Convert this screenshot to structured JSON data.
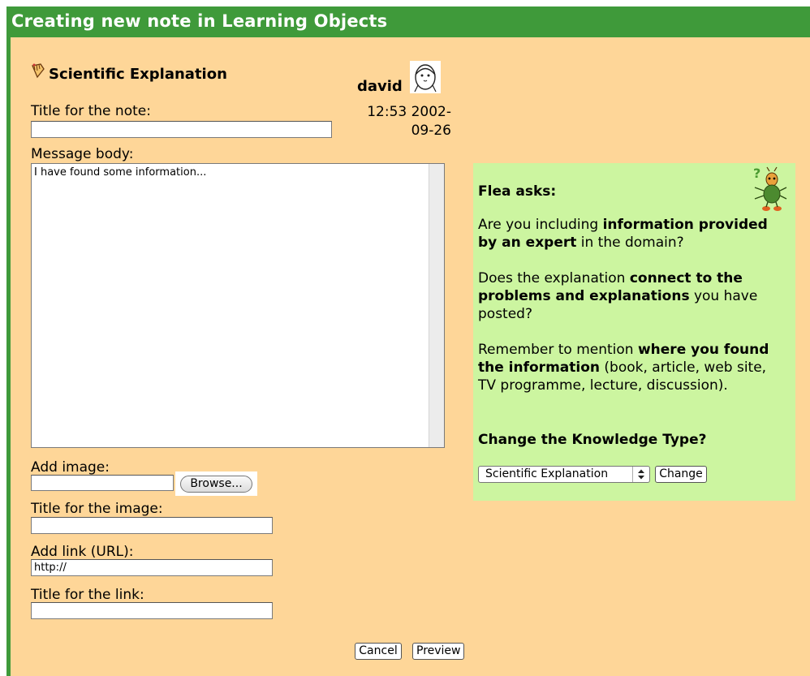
{
  "window": {
    "title": "Creating new note in Learning Objects"
  },
  "note": {
    "knowledge_type": "Scientific Explanation",
    "author": "david",
    "datetime": "12:53 2002-09-26",
    "title_label": "Title for the note:",
    "title_value": "",
    "body_label": "Message body:",
    "body_value": "I have found some information..."
  },
  "attachments": {
    "image_label": "Add image:",
    "browse_label": "Browse...",
    "image_title_label": "Title for the image:",
    "link_label": "Add link (URL):",
    "link_value": "http://",
    "link_title_label": "Title for the link:"
  },
  "flea": {
    "heading": "Flea asks:",
    "q1_pre": "Are you including ",
    "q1_bold": "information provided by an expert",
    "q1_post": " in the domain?",
    "q2_pre": "Does the explanation ",
    "q2_bold": "connect to the problems and explanations",
    "q2_post": " you have posted?",
    "q3_pre": "Remember to mention ",
    "q3_bold": "where you found the information",
    "q3_post": " (book, article, web site, TV programme, lecture, discussion).",
    "change_heading": "Change the Knowledge Type?",
    "select_value": "Scientific Explanation",
    "change_button": "Change"
  },
  "actions": {
    "cancel": "Cancel",
    "preview": "Preview"
  },
  "colors": {
    "titlebar": "#3f9a3a",
    "background": "#fed698",
    "panel": "#ccf5a0"
  },
  "icons": [
    "knowledge-type-icon",
    "user-avatar-icon",
    "flea-icon",
    "select-arrow-icon"
  ]
}
